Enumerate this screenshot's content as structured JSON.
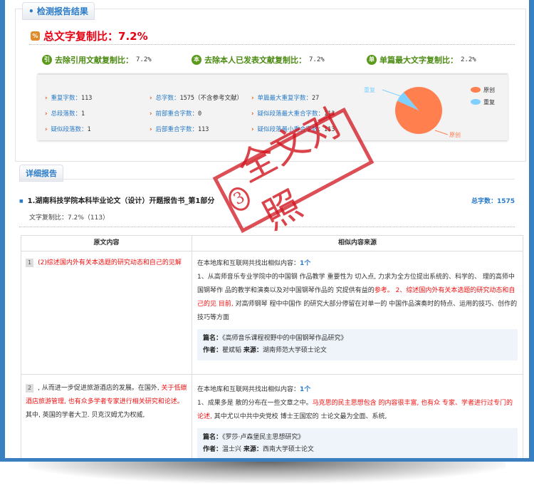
{
  "result_tab": "• 检测报告结果",
  "total": {
    "label": "总文字复制比：7.2%",
    "icon": "percent-hex-icon",
    "icon_text": "%"
  },
  "subs": [
    {
      "icon_text": "引",
      "label": "去除引用文献复制比：",
      "value": "7.2%"
    },
    {
      "icon_text": "本",
      "label": "去除本人已发表文献复制比：",
      "value": "7.2%"
    },
    {
      "icon_text": "单",
      "label": "单篇最大文字复制比：",
      "value": "2.2%"
    }
  ],
  "stats": [
    {
      "label": "重复字数：",
      "value": "113"
    },
    {
      "label": "总字数：",
      "value": "1575（不含参考文献）"
    },
    {
      "label": "单篇最大重复字数：",
      "value": "27"
    },
    {
      "label": "总段落数：",
      "value": "1"
    },
    {
      "label": "前部重合字数：",
      "value": "0"
    },
    {
      "label": "疑似段落最大重合字数：",
      "value": "113"
    },
    {
      "label": "疑似段落数：",
      "value": "1"
    },
    {
      "label": "后部重合字数：",
      "value": "113"
    },
    {
      "label": "疑似段落最小重合字数：",
      "value": "113"
    }
  ],
  "pie": {
    "slices": [
      {
        "name": "原创",
        "value": 92.8,
        "color": "#ff7f4f"
      },
      {
        "name": "重复",
        "value": 7.2,
        "color": "#7fcfff"
      }
    ]
  },
  "detail_tab": "详细报告",
  "section": {
    "title": "1.湖南科技学院本科毕业论文（设计）开题报告书_第1部分",
    "total": "总字数：1575",
    "ratio": "文字复制比：7.2%（113）"
  },
  "table": {
    "headers": [
      "原文内容",
      "相似内容来源"
    ],
    "rows": [
      {
        "num": "1",
        "orig_red": "(2)综述国内外有关本选题的研究动态和自己的见解",
        "orig": "",
        "found": "在本地库和互联网共找出相似内容：",
        "count": "1个",
        "sim_a": "1、从高师音乐专业学院中的中国钢  作品教学  重要性为  切入点, 力求为全方位提出系统的、科学的、  理的高师中国钢琴作  品的教学和演奏以及对中国钢琴作品的  究提供有益的",
        "sim_red": "参考。  2、综述国内外有关本选题的研究动态和自己的见  目前,",
        "sim_b": " 对高师钢琴  程中中国作  的研究大部分停留在对单一的  中国作品演奏时的特点、运用的技巧、创作的技巧等方面",
        "title_label": "篇名：",
        "title": "《高师音乐课程视野中的中国钢琴作品研究》",
        "author_label": "作者：",
        "author": "瞿斌韬",
        "source_label": "来源：",
        "source": "湖南师范大学硕士论文"
      },
      {
        "num": "2",
        "orig_pre": ", 从而进一步促进旅游酒店的发展。在国外, ",
        "orig_red": "关于低碳酒店旅游管理, 也有众多学者专家进行相关研究和论述。",
        "orig": "其中, 英国的学者大卫. 贝克汉姆尤为权威,",
        "found": "在本地库和互联网共找出相似内容：",
        "count": "1个",
        "sim_a": "1、成果多是  散的分布在一些文章之中。",
        "sim_red": "马克思的民主思想包含  的内容很丰富, 也有众  专家、学者进行过专门的论述,",
        "sim_b": " 其中尤以中共中央党校  博士王国宏的  士论文最为全面、系统,",
        "title_label": "篇名：",
        "title": "《罗莎·卢森堡民主思想研究》",
        "author_label": "作者：",
        "author": "温士兴",
        "source_label": "来源：",
        "source": "西南大学硕士论文"
      }
    ]
  },
  "stamp": {
    "num": "3",
    "text": "全文对照"
  }
}
